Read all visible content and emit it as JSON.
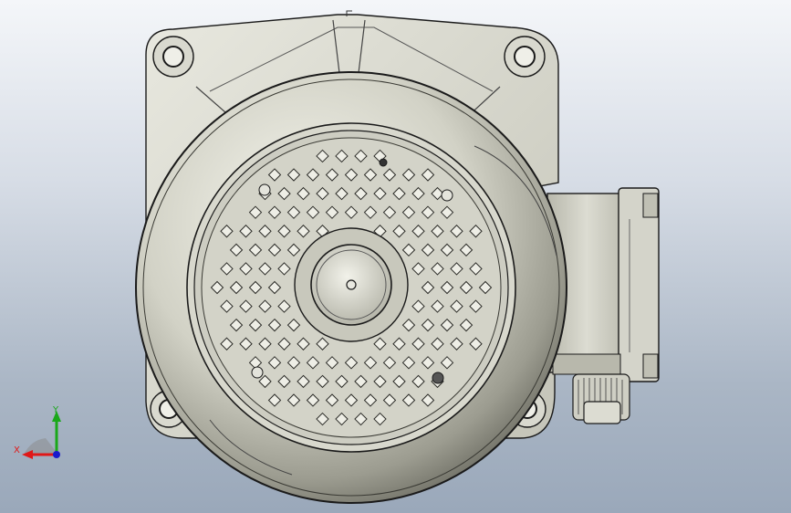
{
  "viewport": {
    "background_top": "#f4f6f9",
    "background_bottom": "#9aa8ba"
  },
  "model": {
    "part_color": "#cfcfc4",
    "edge_color": "#1a1a1a",
    "shadow_color": "#8e8e84"
  },
  "triad": {
    "x_label": "X",
    "y_label": "Y",
    "x_color": "#e01818",
    "y_color": "#1aa81a",
    "z_color": "#1a1acc"
  }
}
